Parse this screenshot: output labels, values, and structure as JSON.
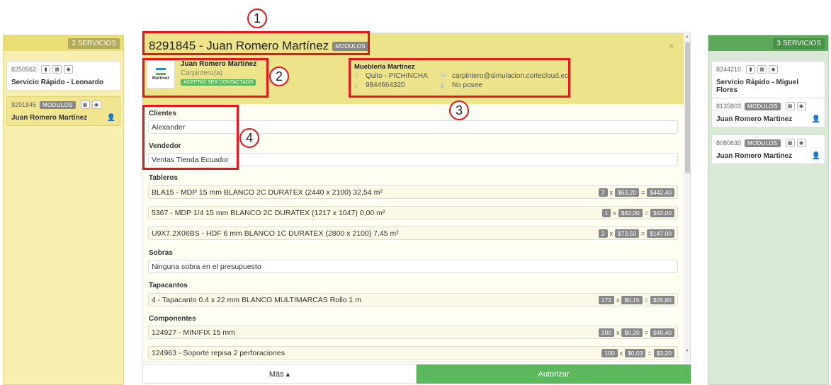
{
  "left_column": {
    "count_label": "2 SERVICIOS",
    "cards": [
      {
        "id": "8250562",
        "tag": "",
        "title": "Servicio Rápido - Leonardo"
      },
      {
        "id": "8291845",
        "tag": "MODULOS",
        "title": "Juan Romero Martínez"
      }
    ]
  },
  "right_column": {
    "count_label": "3 SERVICIOS",
    "cards": [
      {
        "id": "8244210",
        "tag": "",
        "title": "Servicio Rápido - Miguel Flores"
      },
      {
        "id": "8135803",
        "tag": "MODULOS",
        "title": "Juan Romero Martinez"
      },
      {
        "id": "8080630",
        "tag": "MODULOS",
        "title": "Juan Romero Martinez"
      }
    ]
  },
  "header": {
    "title": "8291845 - Juan Romero Martínez",
    "tag": "MODULOS",
    "close": "×"
  },
  "client": {
    "logo_text": "Martinez",
    "name": "Juan Romero Martinez",
    "role": "Carpintero(a)",
    "badge": "ACEPTAS SER CONTACTADO"
  },
  "store": {
    "name": "Muebleria Martinez",
    "location": "Quito - PICHINCHA",
    "phone": "9844664320",
    "email": "carpintero@simulacion.cortecloud.ec",
    "extra": "No posee"
  },
  "fields": {
    "clientes_label": "Clientes",
    "clientes_value": "Alexander",
    "vendedor_label": "Vendedor",
    "vendedor_value": "Ventas Tienda Ecuador",
    "tableros_label": "Tableros",
    "sobras_label": "Sobras",
    "sobras_value": "Ninguna sobra en el presupuesto",
    "tapacantos_label": "Tapacantos",
    "componentes_label": "Componentes"
  },
  "tableros": [
    {
      "desc": "BLA15 - MDP 15 mm BLANCO 2C DURATEX (2440 x 2100) 32,54 m²",
      "qty": "7",
      "price": "$63,20",
      "total": "$442,40"
    },
    {
      "desc": "5367 - MDP 1/4 15 mm BLANCO 2C DURATEX (1217 x 1047) 0,00 m²",
      "qty": "1",
      "price": "$42,00",
      "total": "$42,00"
    },
    {
      "desc": "U9X7.2X06BS - HDF 6 mm BLANCO 1C DURATEX (2800 x 2100) 7,45 m²",
      "qty": "2",
      "price": "$73,50",
      "total": "$147,00"
    }
  ],
  "tapacantos": [
    {
      "desc": "4 - Tapacanto 0.4 x 22 mm BLANCO MULTIMARCAS Rollo 1 m",
      "qty": "172",
      "price": "$0,15",
      "total": "$25,80"
    }
  ],
  "componentes": [
    {
      "desc": "124927 - MINIFIX 15 mm",
      "qty": "200",
      "price": "$0,20",
      "total": "$40,40"
    },
    {
      "desc": "124963 - Soporte repisa 2 perforaciones",
      "qty": "100",
      "price": "$0,03",
      "total": "$3,20"
    }
  ],
  "ops": {
    "x": "x",
    "eq": "="
  },
  "buttons": {
    "more": "Más ▴",
    "authorize": "Autorizar"
  },
  "annotations": [
    "1",
    "2",
    "3",
    "4"
  ],
  "colors": {
    "accent_yellow": "#ece38a",
    "accent_green": "#5cb85c",
    "annotation_red": "#e8161a"
  }
}
